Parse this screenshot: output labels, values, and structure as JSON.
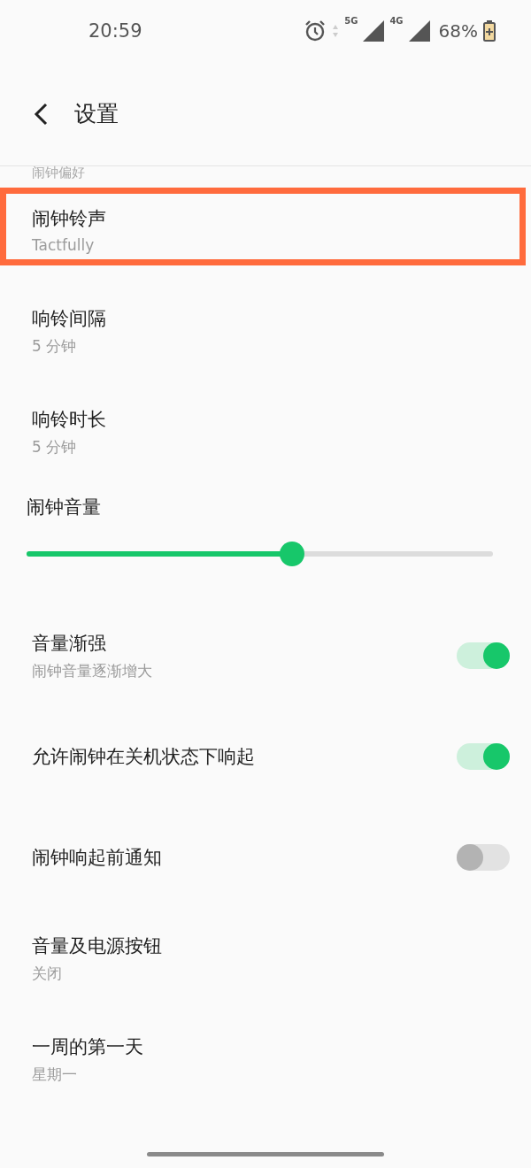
{
  "status_bar": {
    "time": "20:59",
    "network_1": "5G",
    "network_2": "4G",
    "battery": "68%"
  },
  "header": {
    "title": "设置"
  },
  "section_label": "闹钟偏好",
  "items": [
    {
      "kind": "nav",
      "title": "闹钟铃声",
      "subtitle": "Tactfully",
      "highlighted": true
    },
    {
      "kind": "nav",
      "title": "响铃间隔",
      "subtitle": "5 分钟",
      "highlighted": false
    },
    {
      "kind": "nav",
      "title": "响铃时长",
      "subtitle": "5 分钟",
      "highlighted": false
    },
    {
      "kind": "slider",
      "title": "闹钟音量",
      "level": 0.57
    },
    {
      "kind": "switch",
      "title": "音量渐强",
      "subtitle": "闹钟音量逐渐增大",
      "on": true
    },
    {
      "kind": "switch",
      "title": "允许闹钟在关机状态下响起",
      "on": true
    },
    {
      "kind": "switch",
      "title": "闹钟响起前通知",
      "on": false
    },
    {
      "kind": "nav",
      "title": "音量及电源按钮",
      "subtitle": "关闭",
      "highlighted": false
    },
    {
      "kind": "nav",
      "title": "一周的第一天",
      "subtitle": "星期一",
      "highlighted": false
    }
  ]
}
